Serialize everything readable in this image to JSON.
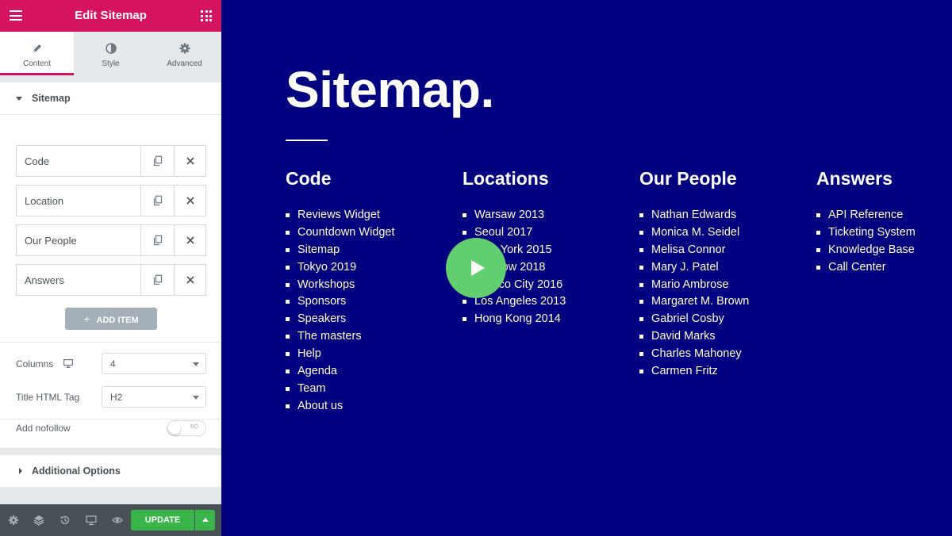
{
  "header": {
    "title": "Edit Sitemap"
  },
  "tabs": [
    {
      "label": "Content",
      "icon": "pencil-icon"
    },
    {
      "label": "Style",
      "icon": "contrast-icon"
    },
    {
      "label": "Advanced",
      "icon": "gear-icon"
    }
  ],
  "section": {
    "title": "Sitemap"
  },
  "repeater": {
    "items": [
      {
        "label": "Code"
      },
      {
        "label": "Location"
      },
      {
        "label": "Our People"
      },
      {
        "label": "Answers"
      }
    ],
    "add_label": "ADD ITEM"
  },
  "controls": {
    "columns_label": "Columns",
    "columns_value": "4",
    "title_tag_label": "Title HTML Tag",
    "title_tag_value": "H2",
    "nofollow_label": "Add nofollow",
    "nofollow_state": "NO"
  },
  "section2": {
    "title": "Additional Options"
  },
  "footer": {
    "update_label": "UPDATE"
  },
  "colors": {
    "brand": "#d5135e",
    "preview_bg": "#000080",
    "link": "#ffffcc",
    "update": "#39b54a",
    "play": "#61ce70"
  },
  "preview": {
    "title": "Sitemap.",
    "columns": [
      {
        "heading": "Code",
        "links": [
          "Reviews Widget",
          "Countdown Widget",
          "Sitemap",
          "Tokyo 2019",
          "Workshops",
          "Sponsors",
          "Speakers",
          "The masters",
          "Help",
          "Agenda",
          "Team",
          "About us"
        ]
      },
      {
        "heading": "Locations",
        "links": [
          "Warsaw 2013",
          "Seoul 2017",
          "New York 2015",
          "Moscow 2018",
          "Mexico City 2016",
          "Los Angeles 2013",
          "Hong Kong 2014"
        ]
      },
      {
        "heading": "Our People",
        "links": [
          "Nathan Edwards",
          "Monica M. Seidel",
          "Melisa Connor",
          "Mary J. Patel",
          "Mario Ambrose",
          "Margaret M. Brown",
          "Gabriel Cosby",
          "David Marks",
          "Charles Mahoney",
          "Carmen Fritz"
        ]
      },
      {
        "heading": "Answers",
        "links": [
          "API Reference",
          "Ticketing System",
          "Knowledge Base",
          "Call Center"
        ]
      }
    ]
  }
}
